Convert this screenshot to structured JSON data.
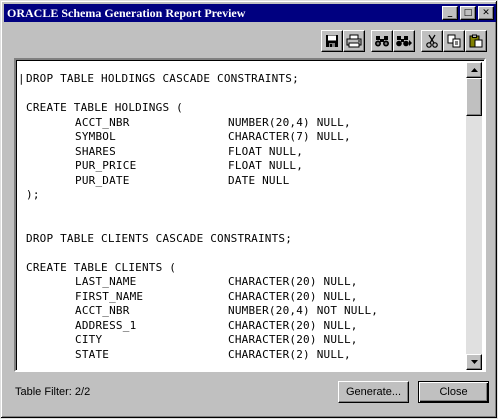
{
  "window": {
    "title": "ORACLE Schema Generation Report Preview",
    "minimize_glyph": "_",
    "maximize_glyph": "□",
    "close_glyph": "✕"
  },
  "toolbar": {
    "buttons": [
      {
        "name": "save-button",
        "icon": "floppy-disk-icon"
      },
      {
        "name": "print-button",
        "icon": "printer-icon"
      },
      {
        "name": "find-button",
        "icon": "binoculars-icon"
      },
      {
        "name": "find-next-button",
        "icon": "binoculars-next-icon"
      },
      {
        "name": "cut-button",
        "icon": "scissors-icon"
      },
      {
        "name": "copy-button",
        "icon": "copy-icon"
      },
      {
        "name": "paste-button",
        "icon": "paste-icon"
      }
    ]
  },
  "code": {
    "lines": [
      {
        "kind": "plain",
        "text": "DROP TABLE HOLDINGS CASCADE CONSTRAINTS;"
      },
      {
        "kind": "blank",
        "text": ""
      },
      {
        "kind": "plain",
        "text": "CREATE TABLE HOLDINGS ("
      },
      {
        "kind": "col",
        "name": "ACCT_NBR",
        "type": "NUMBER(20,4) NULL,"
      },
      {
        "kind": "col",
        "name": "SYMBOL",
        "type": "CHARACTER(7) NULL,"
      },
      {
        "kind": "col",
        "name": "SHARES",
        "type": "FLOAT NULL,"
      },
      {
        "kind": "col",
        "name": "PUR_PRICE",
        "type": "FLOAT NULL,"
      },
      {
        "kind": "col",
        "name": "PUR_DATE",
        "type": "DATE NULL"
      },
      {
        "kind": "plain",
        "text": ");"
      },
      {
        "kind": "blank",
        "text": ""
      },
      {
        "kind": "blank",
        "text": ""
      },
      {
        "kind": "plain",
        "text": "DROP TABLE CLIENTS CASCADE CONSTRAINTS;"
      },
      {
        "kind": "blank",
        "text": ""
      },
      {
        "kind": "plain",
        "text": "CREATE TABLE CLIENTS ("
      },
      {
        "kind": "col",
        "name": "LAST_NAME",
        "type": "CHARACTER(20) NULL,"
      },
      {
        "kind": "col",
        "name": "FIRST_NAME",
        "type": "CHARACTER(20) NULL,"
      },
      {
        "kind": "col",
        "name": "ACCT_NBR",
        "type": "NUMBER(20,4) NOT NULL,"
      },
      {
        "kind": "col",
        "name": "ADDRESS_1",
        "type": "CHARACTER(20) NULL,"
      },
      {
        "kind": "col",
        "name": "CITY",
        "type": "CHARACTER(20) NULL,"
      },
      {
        "kind": "col",
        "name": "STATE",
        "type": "CHARACTER(2) NULL,"
      }
    ],
    "cursor_char": "|"
  },
  "status": {
    "table_filter": "Table Filter: 2/2"
  },
  "buttons": {
    "generate_label": "Generate...",
    "close_label": "Close"
  }
}
